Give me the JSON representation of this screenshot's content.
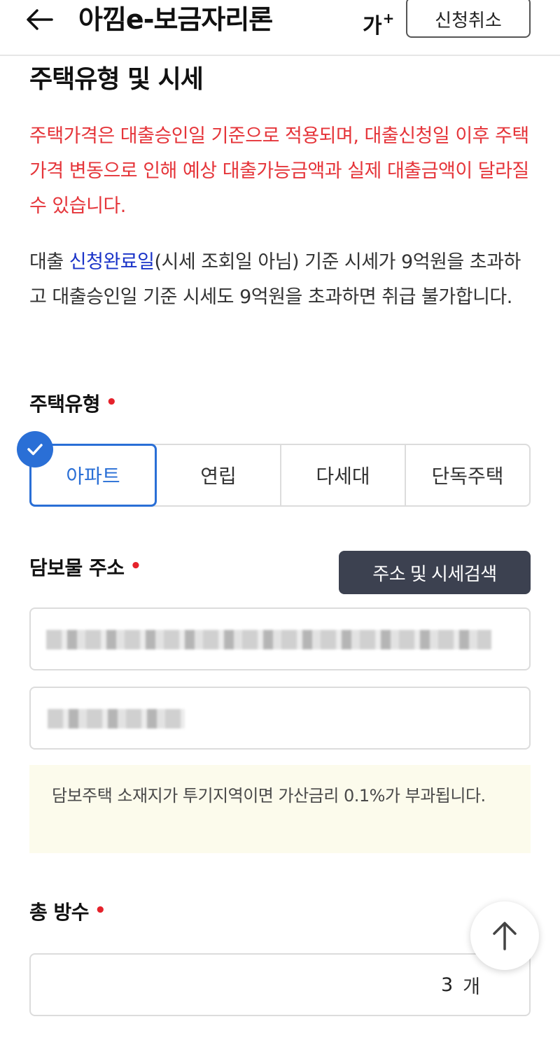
{
  "header": {
    "title": "아낌e-보금자리론",
    "font_size_label": "가",
    "font_size_plus": "+",
    "cancel_label": "신청취소"
  },
  "section": {
    "title": "주택유형 및 시세"
  },
  "warning": {
    "text": "주택가격은 대출승인일 기준으로 적용되며, 대출신청일 이후 주택가격 변동으로 인해 예상 대출가능금액과 실제 대출금액이 달라질 수 있습니다."
  },
  "info": {
    "prefix": "대출 ",
    "highlight": "신청완료일",
    "suffix": "(시세 조회일 아님) 기준 시세가 9억원을 초과하고 대출승인일 기준 시세도 9억원을 초과하면 취급 불가합니다."
  },
  "house_type": {
    "label": "주택유형",
    "required_mark": "•",
    "options": [
      "아파트",
      "연립",
      "다세대",
      "단독주택"
    ],
    "selected": "아파트"
  },
  "address": {
    "label": "담보물 주소",
    "required_mark": "•",
    "search_button": "주소 및 시세검색"
  },
  "notice": {
    "text": "담보주택 소재지가 투기지역이면 가산금리 0.1%가 부과됩니다."
  },
  "rooms": {
    "label": "총 방수",
    "required_mark": "•",
    "value": "3",
    "unit": "개"
  },
  "colors": {
    "accent_blue": "#2a6fd6",
    "warning_red": "#e5353a",
    "highlight_blue": "#1a33c8",
    "dark_button": "#3c4150",
    "notice_bg": "#fcfbec"
  }
}
